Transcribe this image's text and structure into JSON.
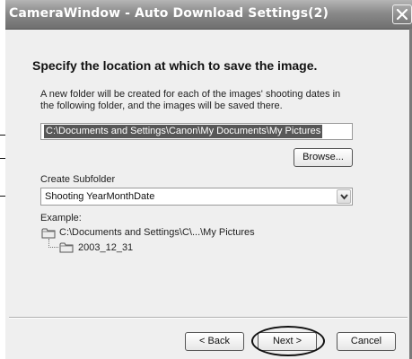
{
  "window": {
    "title": "CameraWindow - Auto Download Settings(2)"
  },
  "page": {
    "heading": "Specify the location at which to save the image.",
    "description": "A new folder will be created for each of the images' shooting dates in the following folder, and the images will be saved there."
  },
  "save_location": {
    "path": "C:\\Documents and Settings\\Canon\\My Documents\\My Pictures",
    "browse_label": "Browse..."
  },
  "subfolder": {
    "label": "Create Subfolder",
    "selected": "Shooting YearMonthDate"
  },
  "example": {
    "label": "Example:",
    "root": "C:\\Documents and Settings\\C\\...\\My Pictures",
    "child": "2003_12_31"
  },
  "footer": {
    "back_label": "< Back",
    "next_label": "Next >",
    "cancel_label": "Cancel"
  },
  "colors": {
    "titlebar": "#8a8a8a",
    "dialog_bg": "#efefef",
    "selection": "#575757"
  },
  "icons": [
    "close-icon",
    "chevron-down-icon",
    "folder-icon"
  ]
}
